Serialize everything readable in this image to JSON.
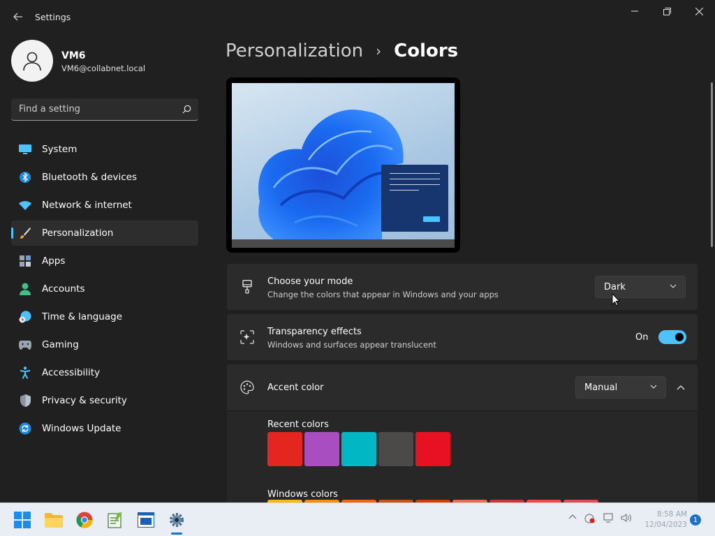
{
  "window": {
    "title": "Settings",
    "controls": [
      "minimize",
      "restore",
      "close"
    ]
  },
  "user": {
    "name": "VM6",
    "email": "VM6@collabnet.local"
  },
  "search": {
    "placeholder": "Find a setting"
  },
  "sidebar": {
    "items": [
      {
        "label": "System",
        "icon": "monitor-icon"
      },
      {
        "label": "Bluetooth & devices",
        "icon": "bluetooth-icon"
      },
      {
        "label": "Network & internet",
        "icon": "wifi-icon"
      },
      {
        "label": "Personalization",
        "icon": "brush-icon",
        "active": true
      },
      {
        "label": "Apps",
        "icon": "apps-icon"
      },
      {
        "label": "Accounts",
        "icon": "person-icon"
      },
      {
        "label": "Time & language",
        "icon": "globe-clock-icon"
      },
      {
        "label": "Gaming",
        "icon": "gamepad-icon"
      },
      {
        "label": "Accessibility",
        "icon": "accessibility-icon"
      },
      {
        "label": "Privacy & security",
        "icon": "shield-icon"
      },
      {
        "label": "Windows Update",
        "icon": "update-icon"
      }
    ]
  },
  "breadcrumb": {
    "parent": "Personalization",
    "separator": "›",
    "current": "Colors"
  },
  "mode_card": {
    "title": "Choose your mode",
    "subtitle": "Change the colors that appear in Windows and your apps",
    "value": "Dark"
  },
  "transparency_card": {
    "title": "Transparency effects",
    "subtitle": "Windows and surfaces appear translucent",
    "state_label": "On",
    "enabled": true
  },
  "accent_card": {
    "title": "Accent color",
    "value": "Manual",
    "expanded": true
  },
  "recent_colors": {
    "label": "Recent colors",
    "colors": [
      "#e52620",
      "#a84ec0",
      "#00b7c3",
      "#4c4a48",
      "#e81123"
    ]
  },
  "windows_colors": {
    "label": "Windows colors",
    "colors": [
      "#ffb900",
      "#ff8c00",
      "#f7630c",
      "#ca5010",
      "#da3b01",
      "#ef6950",
      "#d13438",
      "#ff4343",
      "#e74856"
    ]
  },
  "taskbar": {
    "apps": [
      "windows-start-icon",
      "file-explorer-icon",
      "chrome-icon",
      "notepad-icon",
      "window-app-icon",
      "settings-gear-icon"
    ],
    "clock_time": "8:58 AM",
    "clock_date": "12/04/2023",
    "notification_count": "1"
  },
  "colors": {
    "accent": "#4cc2ff",
    "background": "#202020",
    "card": "#2b2b2b"
  }
}
